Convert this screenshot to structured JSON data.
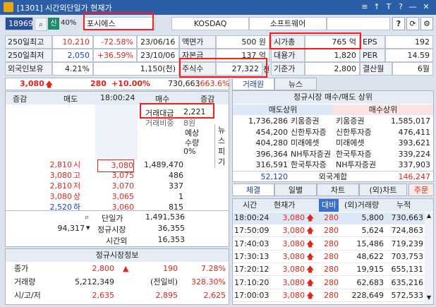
{
  "window": {
    "title": "[1301] 시간외단일가 현재가",
    "buttons": [
      "≡",
      "↑",
      "T",
      "?",
      "—",
      "✕"
    ]
  },
  "header": {
    "code": "189690",
    "sin_label": "신",
    "percent": "40%",
    "name": "포시에스",
    "market": "KOSDAQ",
    "sector": "소프트웨어",
    "help": "?"
  },
  "info": {
    "high250_label": "250일최고",
    "high250_value": "10,210",
    "high250_pct": "-72.58%",
    "high250_date": "23/06/16",
    "par_label": "액면가",
    "par_value": "500 원",
    "mcap_label": "시가총",
    "mcap_value": "765 억",
    "eps_label": "EPS",
    "eps_value": "192",
    "low250_label": "250일최저",
    "low250_value": "2,050",
    "low250_pct": "+36.59%",
    "low250_date": "23/10/06",
    "capital_label": "자본금",
    "capital_value": "137 억",
    "loan_label": "대용가",
    "loan_value": "1,820",
    "per_label": "PER",
    "per_value": "14.59",
    "foreign_label": "외국인보유",
    "foreign_pct": "4.21%",
    "foreign_qty": "1,150(천)",
    "shares_label": "주식수",
    "shares_value": "27,322",
    "shares_unit": "천",
    "base_label": "기준가",
    "base_value": "2,800",
    "fiscal_label": "결산월",
    "fiscal_value": "6월"
  },
  "price_bar": {
    "price": "3,080",
    "change": "280",
    "pct": "+10.00%",
    "volume": "730,663",
    "vol_pct": ",663.6%"
  },
  "order_book": {
    "headers": [
      "증감",
      "매도",
      "18:00:24",
      "매수",
      "증감"
    ],
    "trade_amount_label": "거래대금",
    "trade_amount": "2,221",
    "trade_ratio_label": "거래비중",
    "trade_ratio": "8원",
    "expected_label": "예상",
    "expected_qty_label": "수량",
    "expected_pct": "0%",
    "side_tabs": [
      "뉴",
      "스",
      "피",
      "기"
    ],
    "ask_rows": [
      {
        "price": "3,080",
        "qty": "1,489,470"
      },
      {
        "price": "3,075",
        "qty": "486"
      },
      {
        "price": "3,070",
        "qty": "337"
      },
      {
        "price": "3,065",
        "qty": "1"
      },
      {
        "price": "3,060",
        "qty": "815"
      }
    ],
    "ref_rows": [
      {
        "value": "2,810",
        "label": "시",
        "color": "red"
      },
      {
        "value": "3,080",
        "label": "고",
        "color": "red"
      },
      {
        "value": "2,810",
        "label": "저",
        "color": "red"
      },
      {
        "value": "3,080",
        "label": "상",
        "color": "red"
      },
      {
        "value": "2,520",
        "label": "하",
        "color": "blue"
      }
    ],
    "single_label": "단일가",
    "single_value": "1,491,536",
    "regular_label": "정규시장",
    "regular_value": "36,355",
    "after_label": "시간외",
    "after_value": "16,353",
    "left_total": "94,317"
  },
  "regular_info": {
    "title": "정규시장정보",
    "rows": [
      {
        "label": "종가",
        "v1": "2,800",
        "mark": "▲",
        "v2": "190",
        "v3": "7.28%"
      },
      {
        "label": "거래량",
        "v1": "5,212,349",
        "mark": "",
        "v2": "(전일비)",
        "v3": "328.30%"
      },
      {
        "label": "시/고/저",
        "v1": "2,635",
        "mark": "",
        "v2": "2,895",
        "v3": "2,625"
      }
    ]
  },
  "brokers": {
    "tabs": [
      "거래원",
      "뉴스"
    ],
    "title": "정규시장 매수/매도 상위",
    "sell_header": "매도상위",
    "buy_header": "매수상위",
    "rows": [
      {
        "sq": "1,736,286",
        "sn": "키움증권",
        "bn": "키움증권",
        "bq": "1,585,017"
      },
      {
        "sq": "454,200",
        "sn": "신한투자증",
        "bn": "신한투자증",
        "bq": "476,411"
      },
      {
        "sq": "404,280",
        "sn": "미래에셋",
        "bn": "미래에셋",
        "bq": "393,621"
      },
      {
        "sq": "396,364",
        "sn": "NH투자증권",
        "bn": "한국투자증",
        "bq": "339,224"
      },
      {
        "sq": "316,591",
        "sn": "한국투자증",
        "bn": "NH투자증권",
        "bq": "337,903"
      }
    ],
    "foreign_sell": "52,120",
    "foreign_label": "외국계합",
    "foreign_buy": "146,247"
  },
  "ticks": {
    "tabs": [
      "체결",
      "일별",
      "차트",
      "(외)차트",
      "주문"
    ],
    "headers": [
      "시간",
      "현재가",
      "대비",
      "(외)거래량",
      "누적"
    ],
    "rows": [
      {
        "t": "18:00:24",
        "p": "3,080",
        "d": "280",
        "v": "5,800",
        "c": "730,663"
      },
      {
        "t": "17:50:09",
        "p": "3,080",
        "d": "280",
        "v": "5,624",
        "c": "724,863"
      },
      {
        "t": "17:40:03",
        "p": "3,080",
        "d": "280",
        "v": "15,486",
        "c": "719,239"
      },
      {
        "t": "17:30:13",
        "p": "3,080",
        "d": "280",
        "v": "48,622",
        "c": "703,753"
      },
      {
        "t": "17:20:12",
        "p": "3,080",
        "d": "280",
        "v": "19,915",
        "c": "655,131"
      },
      {
        "t": "17:10:20",
        "p": "3,080",
        "d": "280",
        "v": "62,683",
        "c": "635,216"
      },
      {
        "t": "17:00:03",
        "p": "3,080",
        "d": "280",
        "v": "228,649",
        "c": "572,533"
      }
    ]
  }
}
